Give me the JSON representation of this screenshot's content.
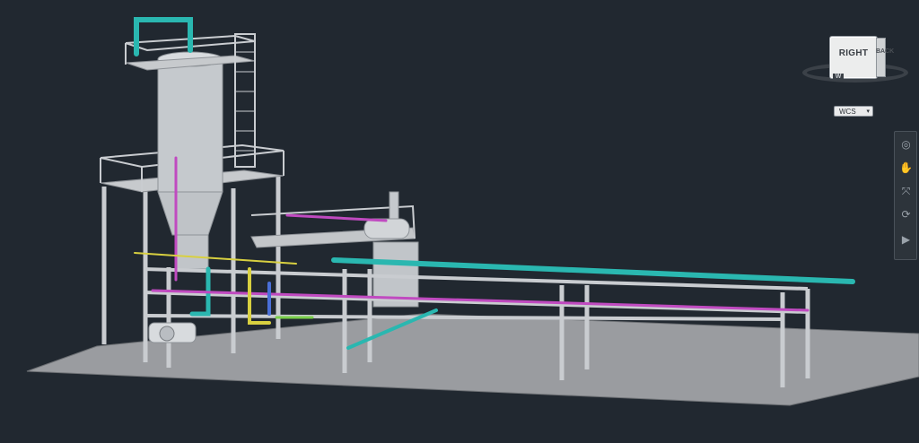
{
  "viewcube": {
    "face_label": "RIGHT",
    "side_label": "BACK",
    "compass_label": "W"
  },
  "ucs": {
    "label": "WCS",
    "caret": "▾"
  },
  "navbar": {
    "items": [
      {
        "icon": "steering-wheel-icon",
        "glyph": "◎"
      },
      {
        "icon": "pan-hand-icon",
        "glyph": "✋"
      },
      {
        "icon": "zoom-extents-icon",
        "glyph": "⤧"
      },
      {
        "icon": "orbit-icon",
        "glyph": "⟳"
      },
      {
        "icon": "show-motion-icon",
        "glyph": "▶"
      }
    ]
  },
  "colors": {
    "background": "#212830",
    "ground": "#9a9ca0",
    "steel": "#b9bdc2",
    "vessel": "#c5c9cd",
    "pipe_cyan": "#2ab7b0",
    "pipe_magenta": "#c04ac0",
    "pipe_yellow": "#d8d040",
    "pipe_blue": "#4a6fd8",
    "pipe_green": "#7ad04a"
  }
}
